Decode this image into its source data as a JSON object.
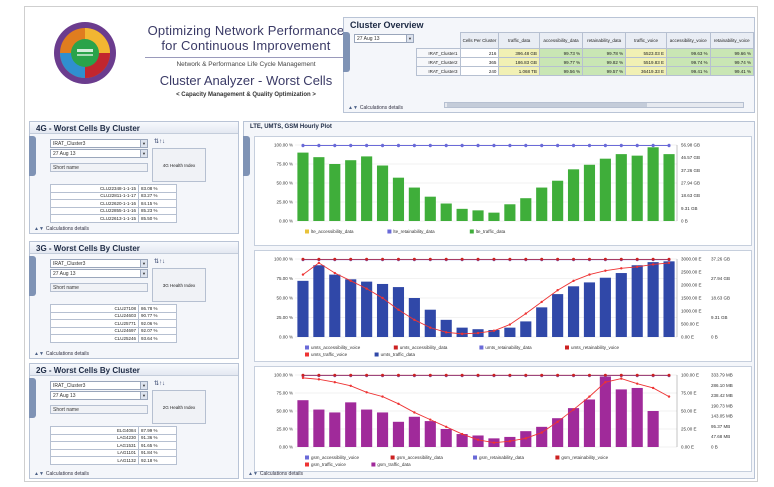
{
  "header": {
    "title_line1": "Optimizing Network Performance",
    "title_line2": "for Continuous Improvement",
    "subtitle": "Network & Performance Life Cycle Management",
    "app_name": "Cluster Analyzer - Worst Cells",
    "tagline": "< Capacity Management & Quality Optimization >"
  },
  "overview": {
    "title": "Cluster Overview",
    "date": "27 Aug 13",
    "columns": [
      "Cells Per Cluster",
      "traffic_data",
      "accessibility_data",
      "retainability_data",
      "traffic_voice",
      "accessibility_voice",
      "retainability_voice"
    ],
    "rows": [
      {
        "name": "IRAT_Cluster1",
        "cells": "216",
        "traffic_data": "396.48 GB",
        "acc_data": "99.73 %",
        "ret_data": "99.78 %",
        "traffic_voice": "5523.03 E",
        "acc_voice": "99.63 %",
        "ret_voice": "99.66 %"
      },
      {
        "name": "IRAT_Cluster2",
        "cells": "365",
        "traffic_data": "186.83 GB",
        "acc_data": "99.77 %",
        "ret_data": "99.82 %",
        "traffic_voice": "5519.83 E",
        "acc_voice": "99.74 %",
        "ret_voice": "99.74 %"
      },
      {
        "name": "IRAT_Cluster3",
        "cells": "240",
        "traffic_data": "1.068 TB",
        "acc_data": "99.56 %",
        "ret_data": "99.57 %",
        "traffic_voice": "36419.33 E",
        "acc_voice": "99.41 %",
        "ret_voice": "99.41 %"
      }
    ],
    "calc": "Calculations details"
  },
  "wc4g": {
    "title": "4G - Worst Cells By Cluster",
    "cluster": "IRAT_Cluster3",
    "date": "27 Aug 13",
    "health_label": "4G Health Index",
    "short_name": "Short name",
    "rows": [
      {
        "name": "CLU22348-1-1-15",
        "value": "83.08 %"
      },
      {
        "name": "CLU22811-1-1-17",
        "value": "83.27 %"
      },
      {
        "name": "CLU22620-1-1-16",
        "value": "84.15 %"
      },
      {
        "name": "CLU22855-1-1-16",
        "value": "85.23 %"
      },
      {
        "name": "CLU22613-1-1-15",
        "value": "85.50 %"
      }
    ],
    "calc": "Calculations details"
  },
  "wc3g": {
    "title": "3G - Worst Cells By Cluster",
    "cluster": "IRAT_Cluster3",
    "date": "27 Aug 13",
    "health_label": "3G Health Index",
    "short_name": "Short name",
    "rows": [
      {
        "name": "CLU27108",
        "value": "86.78 %"
      },
      {
        "name": "CLU24603",
        "value": "90.77 %"
      },
      {
        "name": "CLU25771",
        "value": "92.06 %"
      },
      {
        "name": "CLU24697",
        "value": "92.07 %"
      },
      {
        "name": "CLU25246",
        "value": "93.64 %"
      }
    ],
    "calc": "Calculations details"
  },
  "wc2g": {
    "title": "2G - Worst Cells By Cluster",
    "cluster": "IRAT_Cluster3",
    "date": "27 Aug 13",
    "health_label": "2G Health Index",
    "short_name": "Short name",
    "rows": [
      {
        "name": "ELG4084",
        "value": "87.99 %"
      },
      {
        "name": "LAG4230",
        "value": "91.36 %"
      },
      {
        "name": "LAG1531",
        "value": "91.65 %"
      },
      {
        "name": "LAG1101",
        "value": "91.84 %"
      },
      {
        "name": "LAG1132",
        "value": "92.18 %"
      }
    ],
    "calc": "Calculations details"
  },
  "hourly": {
    "title": "LTE, UMTS, GSM Hourly Plot",
    "calc": "Calculations details"
  },
  "colors": {
    "lte_bar": "#3fae3a",
    "umts_bar": "#3048a8",
    "gsm_bar": "#a02a9a",
    "access": "#6a6ad8",
    "retain": "#c22",
    "traffic_line": "#e33"
  },
  "chart_data": [
    {
      "type": "bar",
      "title": "",
      "y_ticks_left": [
        "100.00 %",
        "75.00 %",
        "50.00 %",
        "25.00 %",
        "0.00 %"
      ],
      "y_ticks_right": [
        "56.98 GB",
        "46.57 GB",
        "37.26 GB",
        "27.94 GB",
        "18.63 GB",
        "9.31 GB",
        "0 B"
      ],
      "series": [
        {
          "name": "lte_accessibility_data",
          "values": [
            99,
            99,
            99,
            99,
            99,
            99,
            99,
            99,
            99,
            99,
            99,
            99,
            99,
            99,
            99,
            99,
            99,
            99,
            99,
            99,
            99,
            99,
            99,
            99
          ]
        },
        {
          "name": "lte_retainability_data",
          "values": [
            99,
            99,
            99,
            99,
            99,
            99,
            99,
            99,
            99,
            99,
            99,
            99,
            99,
            99,
            99,
            99,
            99,
            99,
            99,
            99,
            99,
            99,
            99,
            99
          ]
        },
        {
          "name": "lte_traffic_data",
          "values": [
            90,
            84,
            75,
            80,
            85,
            73,
            57,
            44,
            32,
            23,
            16,
            14,
            11,
            22,
            30,
            44,
            53,
            68,
            74,
            82,
            88,
            86,
            97,
            88
          ]
        }
      ]
    },
    {
      "type": "bar",
      "title": "",
      "y_ticks_left": [
        "100.00 %",
        "75.00 %",
        "50.00 %",
        "25.00 %",
        "0.00 %"
      ],
      "y_ticks_right": [
        "3000.00 E",
        "2500.00 E",
        "2000.00 E",
        "1500.00 E",
        "1000.00 E",
        "500.00 E",
        "0.00 E"
      ],
      "y_ticks_right2": [
        "37.26 GB",
        "27.94 GB",
        "18.63 GB",
        "9.31 GB",
        "0 B"
      ],
      "series": [
        {
          "name": "umts_accessibility_voice",
          "values": [
            99,
            99,
            99,
            99,
            99,
            99,
            99,
            99,
            99,
            99,
            99,
            99,
            99,
            99,
            99,
            99,
            99,
            99,
            99,
            99,
            99,
            99,
            99,
            99
          ]
        },
        {
          "name": "umts_accessibility_data",
          "values": [
            99,
            99,
            99,
            99,
            99,
            99,
            99,
            99,
            99,
            99,
            99,
            99,
            99,
            99,
            99,
            99,
            99,
            99,
            99,
            99,
            99,
            99,
            99,
            99
          ]
        },
        {
          "name": "umts_retainability_data",
          "values": [
            99,
            99,
            99,
            99,
            99,
            99,
            99,
            99,
            99,
            99,
            99,
            99,
            99,
            99,
            99,
            99,
            99,
            99,
            99,
            99,
            99,
            99,
            99,
            99
          ]
        },
        {
          "name": "umts_retainability_voice",
          "values": [
            99,
            99,
            99,
            99,
            99,
            99,
            99,
            99,
            99,
            99,
            99,
            99,
            99,
            99,
            99,
            99,
            99,
            99,
            99,
            99,
            99,
            99,
            99,
            99
          ]
        },
        {
          "name": "umts_traffic_voice",
          "values": [
            80,
            95,
            82,
            72,
            62,
            50,
            35,
            22,
            12,
            6,
            4,
            5,
            8,
            16,
            30,
            45,
            60,
            72,
            80,
            85,
            88,
            90,
            93,
            95
          ]
        },
        {
          "name": "umts_traffic_data",
          "values": [
            72,
            92,
            80,
            74,
            71,
            68,
            64,
            50,
            35,
            22,
            12,
            10,
            9,
            12,
            20,
            38,
            55,
            65,
            70,
            76,
            82,
            92,
            96,
            97
          ]
        }
      ]
    },
    {
      "type": "bar",
      "title": "",
      "y_ticks_left": [
        "100.00 %",
        "75.00 %",
        "50.00 %",
        "25.00 %",
        "0.00 %"
      ],
      "y_ticks_right": [
        "100.00 E",
        "75.00 E",
        "50.00 E",
        "25.00 E",
        "0.00 E"
      ],
      "y_ticks_right2": [
        "333.79 MB",
        "286.10 MB",
        "238.42 MB",
        "190.73 MB",
        "143.05 MB",
        "95.37 MB",
        "47.68 MB",
        "0 B"
      ],
      "series": [
        {
          "name": "gsm_accessibility_voice",
          "values": [
            99,
            99,
            99,
            99,
            99,
            99,
            99,
            99,
            99,
            99,
            99,
            99,
            99,
            99,
            99,
            99,
            99,
            99,
            99,
            99,
            99,
            99,
            99,
            99
          ]
        },
        {
          "name": "gsm_accessibility_data",
          "values": [
            99,
            99,
            99,
            99,
            99,
            99,
            99,
            99,
            99,
            99,
            99,
            99,
            99,
            99,
            99,
            99,
            99,
            99,
            99,
            99,
            99,
            99,
            99,
            99
          ]
        },
        {
          "name": "gsm_retainability_data",
          "values": [
            99,
            99,
            99,
            99,
            99,
            99,
            99,
            99,
            99,
            99,
            99,
            99,
            99,
            99,
            99,
            99,
            99,
            99,
            99,
            99,
            99,
            99,
            99,
            99
          ]
        },
        {
          "name": "gsm_retainability_voice",
          "values": [
            99,
            99,
            99,
            99,
            99,
            99,
            99,
            99,
            99,
            99,
            99,
            99,
            99,
            99,
            99,
            99,
            99,
            99,
            99,
            99,
            99,
            99,
            99,
            99
          ]
        },
        {
          "name": "gsm_traffic_voice",
          "values": [
            96,
            94,
            90,
            85,
            76,
            70,
            60,
            48,
            38,
            28,
            18,
            10,
            6,
            8,
            12,
            20,
            35,
            52,
            70,
            90,
            95,
            88,
            82,
            70
          ]
        },
        {
          "name": "gsm_traffic_data",
          "values": [
            65,
            52,
            48,
            62,
            52,
            48,
            35,
            42,
            36,
            25,
            18,
            16,
            12,
            14,
            22,
            28,
            40,
            54,
            66,
            98,
            80,
            82,
            50,
            0
          ]
        }
      ]
    }
  ]
}
